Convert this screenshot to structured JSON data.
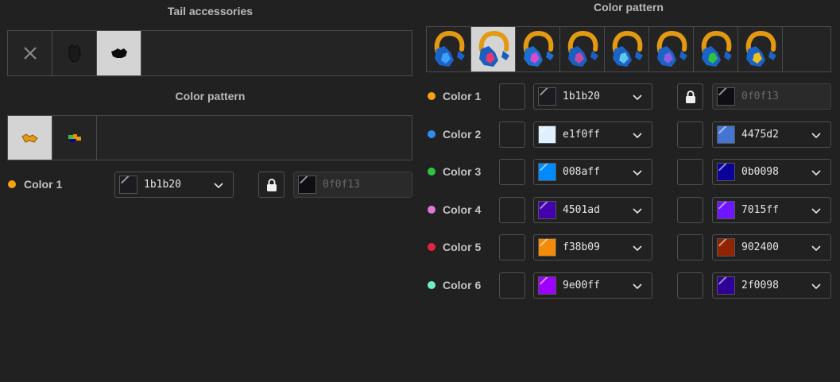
{
  "left": {
    "tail_accessories_title": "Tail accessories",
    "accessories": [
      {
        "icon": "close-icon",
        "selected": false
      },
      {
        "icon": "dark-tail-accessory-icon",
        "selected": false
      },
      {
        "icon": "black-tail-accessory-icon",
        "selected": true
      }
    ],
    "color_pattern_title": "Color pattern",
    "patterns": [
      {
        "icon": "orange-pattern-icon",
        "selected": true
      },
      {
        "icon": "multicolor-pattern-icon",
        "selected": false
      }
    ],
    "colors": [
      {
        "label": "Color 1",
        "dot": "#f5a20e",
        "value": "1b1b20",
        "swatch": "#1b1b20",
        "locked_value": "0f0f13",
        "locked_swatch": "#0f0f13"
      }
    ]
  },
  "right": {
    "color_pattern_title": "Color pattern",
    "patterns": [
      {
        "icon": "tail-pattern-1-icon",
        "selected": false
      },
      {
        "icon": "tail-pattern-2-icon",
        "selected": true
      },
      {
        "icon": "tail-pattern-3-icon",
        "selected": false
      },
      {
        "icon": "tail-pattern-4-icon",
        "selected": false
      },
      {
        "icon": "tail-pattern-5-icon",
        "selected": false
      },
      {
        "icon": "tail-pattern-6-icon",
        "selected": false
      },
      {
        "icon": "tail-pattern-7-icon",
        "selected": false
      },
      {
        "icon": "tail-pattern-8-icon",
        "selected": false
      }
    ],
    "colors": [
      {
        "label": "Color 1",
        "dot": "#f5a20e",
        "value": "1b1b20",
        "swatch": "#1b1b20",
        "value2": "0f0f13",
        "swatch2": "#0f0f13",
        "locked": true
      },
      {
        "label": "Color 2",
        "dot": "#2f8cf0",
        "value": "e1f0ff",
        "swatch": "#e1f0ff",
        "value2": "4475d2",
        "swatch2": "#4475d2",
        "locked": false
      },
      {
        "label": "Color 3",
        "dot": "#2ec441",
        "value": "008aff",
        "swatch": "#008aff",
        "value2": "0b0098",
        "swatch2": "#0b0098",
        "locked": false
      },
      {
        "label": "Color 4",
        "dot": "#df77d6",
        "value": "4501ad",
        "swatch": "#4501ad",
        "value2": "7015ff",
        "swatch2": "#7015ff",
        "locked": false
      },
      {
        "label": "Color 5",
        "dot": "#e8233f",
        "value": "f38b09",
        "swatch": "#f38b09",
        "value2": "902400",
        "swatch2": "#902400",
        "locked": false
      },
      {
        "label": "Color 6",
        "dot": "#6ff0c4",
        "value": "9e00ff",
        "swatch": "#9e00ff",
        "value2": "2f0098",
        "swatch2": "#2f0098",
        "locked": false
      }
    ]
  }
}
